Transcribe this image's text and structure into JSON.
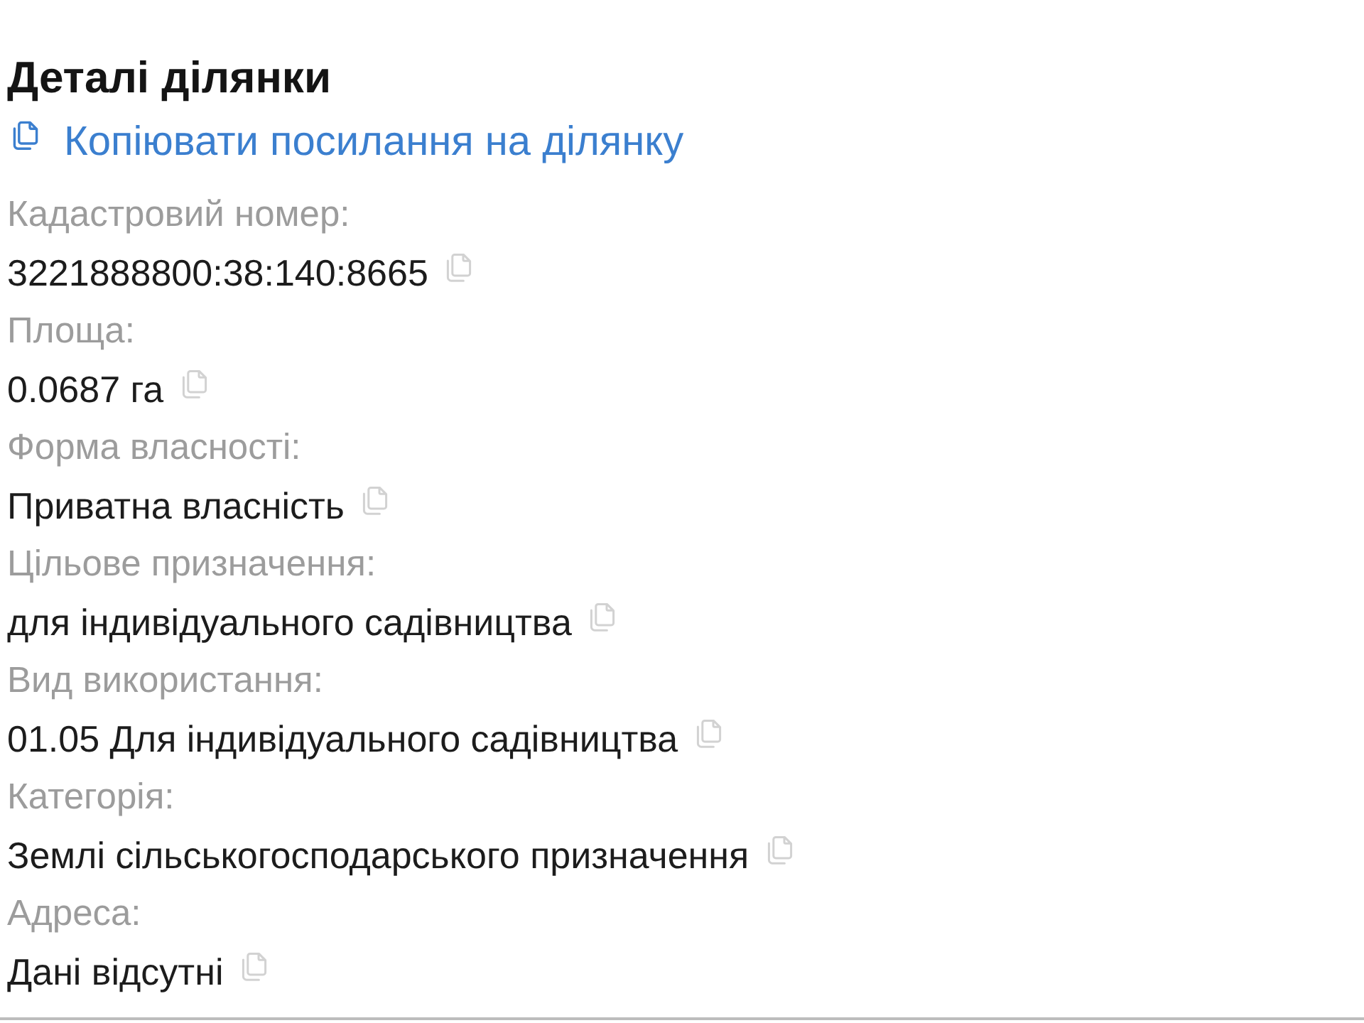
{
  "title": "Деталі ділянки",
  "copy_link": {
    "label": "Копіювати посилання на ділянку"
  },
  "fields": [
    {
      "label": "Кадастровий номер:",
      "value": "3221888800:38:140:8665"
    },
    {
      "label": "Площа:",
      "value": "0.0687 га"
    },
    {
      "label": "Форма власності:",
      "value": "Приватна власність"
    },
    {
      "label": "Цільове призначення:",
      "value": "для індивідуального садівництва"
    },
    {
      "label": "Вид використання:",
      "value": "01.05 Для індивідуального садівництва"
    },
    {
      "label": "Категорія:",
      "value": "Землі сільськогосподарського призначення"
    },
    {
      "label": "Адреса:",
      "value": "Дані відсутні"
    }
  ]
}
